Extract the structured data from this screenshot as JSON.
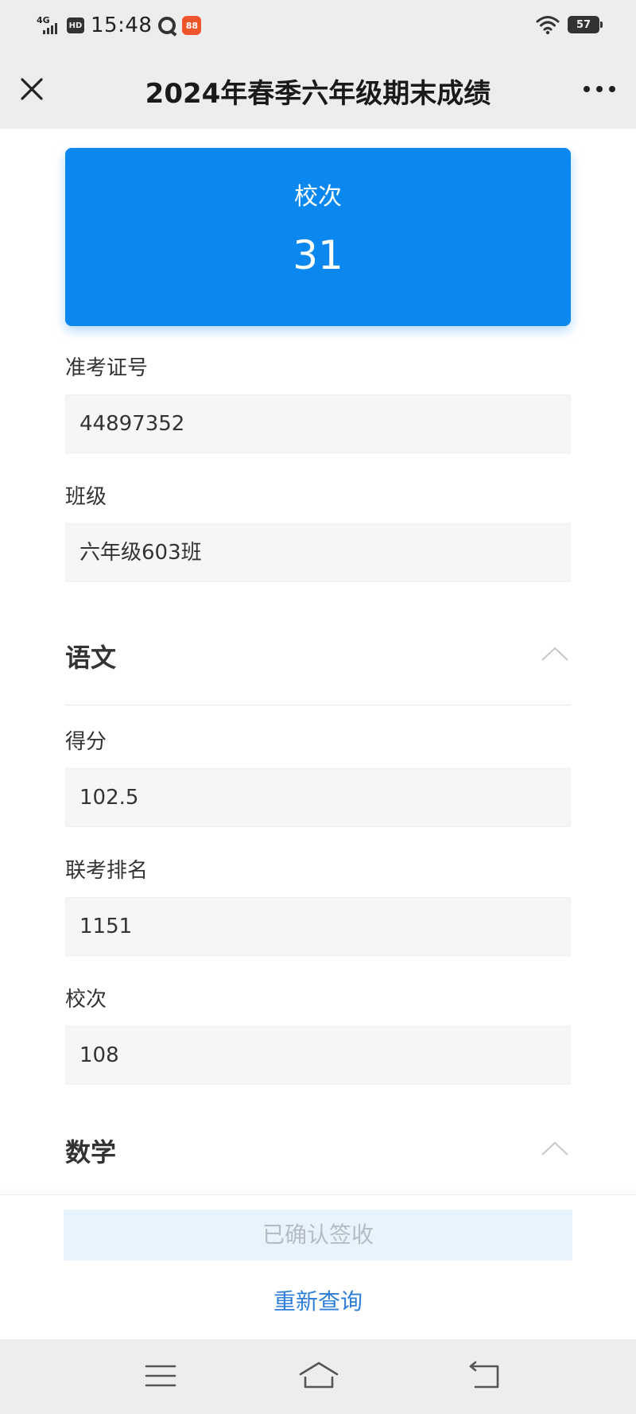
{
  "status_bar": {
    "network": "4G",
    "hd": "HD",
    "time": "15:48",
    "app_badge": "88",
    "battery": "57",
    "icons": [
      "signal-icon",
      "hd-icon",
      "q-app-icon",
      "app-badge-icon",
      "wifi-icon",
      "battery-icon"
    ]
  },
  "nav": {
    "title": "2024年春季六年级期末成绩",
    "close_icon": "close-icon",
    "more_icon": "more-icon"
  },
  "rank_card": {
    "label": "校次",
    "value": "31",
    "color": "#0a88f0"
  },
  "fields": [
    {
      "label": "准考证号",
      "value": "44897352"
    },
    {
      "label": "班级",
      "value": "六年级603班"
    }
  ],
  "sections": [
    {
      "title": "语文",
      "expanded": true,
      "fields": [
        {
          "label": "得分",
          "value": "102.5"
        },
        {
          "label": "联考排名",
          "value": "1151"
        },
        {
          "label": "校次",
          "value": "108"
        }
      ]
    },
    {
      "title": "数学",
      "expanded": true
    }
  ],
  "actions": {
    "confirm_label": "已确认签收",
    "requery_label": "重新查询",
    "link_color": "#2f7fd8"
  },
  "system_nav": {
    "icons": [
      "menu-icon",
      "home-icon",
      "back-icon"
    ]
  }
}
